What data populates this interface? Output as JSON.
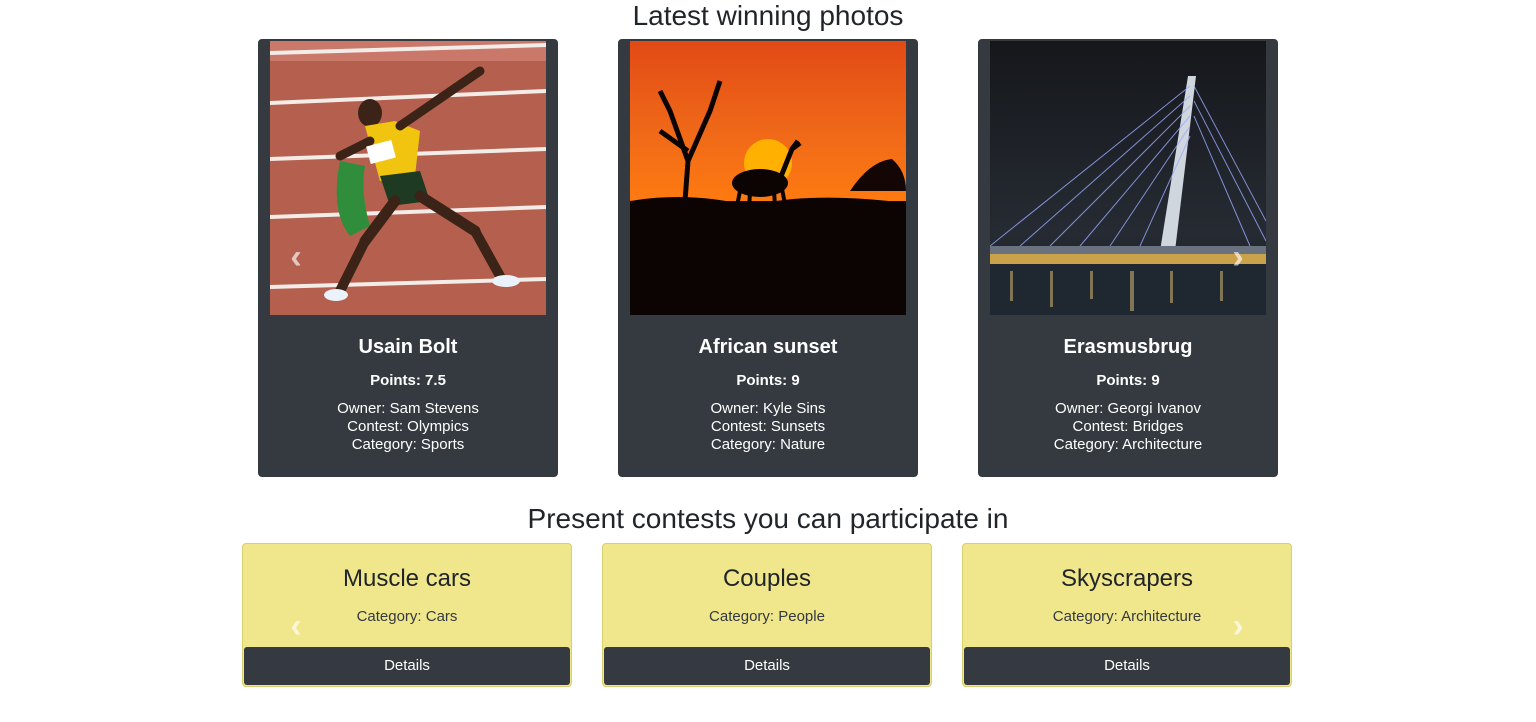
{
  "winners": {
    "title": "Latest winning photos",
    "photos": [
      {
        "title": "Usain Bolt",
        "points": "Points: 7.5",
        "owner": "Owner: Sam Stevens",
        "contest": "Contest: Olympics",
        "category": "Category: Sports"
      },
      {
        "title": "African sunset",
        "points": "Points: 9",
        "owner": "Owner: Kyle Sins",
        "contest": "Contest: Sunsets",
        "category": "Category: Nature"
      },
      {
        "title": "Erasmusbrug",
        "points": "Points: 9",
        "owner": "Owner: Georgi Ivanov",
        "contest": "Contest: Bridges",
        "category": "Category: Architecture"
      }
    ]
  },
  "contests": {
    "title": "Present contests you can participate in",
    "items": [
      {
        "name": "Muscle cars",
        "category": "Category: Cars",
        "button": "Details"
      },
      {
        "name": "Couples",
        "category": "Category: People",
        "button": "Details"
      },
      {
        "name": "Skyscrapers",
        "category": "Category: Architecture",
        "button": "Details"
      }
    ]
  },
  "icons": {
    "prev": "chevron-left-icon",
    "next": "chevron-right-icon"
  },
  "colors": {
    "card_dark": "#343a40",
    "contest_card": "#f0e68c"
  }
}
